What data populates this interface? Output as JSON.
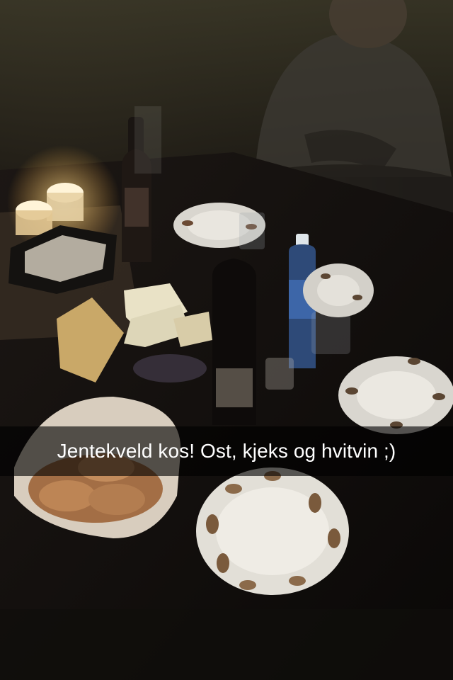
{
  "snap": {
    "caption": "Jentekveld kos! Ost, kjeks og hvitvin ;)"
  },
  "photo": {
    "subject_icons": [
      "candle-icon",
      "wine-bottle-icon",
      "water-bottle-icon",
      "cheese-icon",
      "cracker-icon",
      "plate-icon",
      "person-icon"
    ]
  },
  "colors": {
    "caption_bar": "#000000",
    "caption_text": "#ffffff",
    "candle_glow": "#ffd27a",
    "plate": "#d9d6cf"
  }
}
